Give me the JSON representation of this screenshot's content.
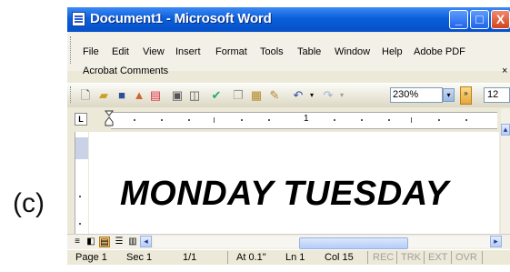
{
  "caption": "(c)",
  "window": {
    "title": "Document1 - Microsoft Word",
    "controls": {
      "minimize": "_",
      "maximize": "□",
      "close": "X"
    }
  },
  "menu": {
    "row1": [
      "File",
      "Edit",
      "View",
      "Insert",
      "Format",
      "Tools",
      "Table",
      "Window",
      "Help",
      "Adobe PDF"
    ],
    "row2": [
      "Acrobat Comments"
    ],
    "overflow": "×"
  },
  "toolbar": {
    "icons": [
      "new-icon",
      "open-icon",
      "save-icon",
      "permission-icon",
      "print-icon",
      "print-preview-icon",
      "spelling-icon",
      "copy-icon",
      "paste-icon",
      "format-painter-icon",
      "undo-icon",
      "redo-icon"
    ],
    "zoom": "230%",
    "font_size": "12"
  },
  "ruler": {
    "marker": "1"
  },
  "document": {
    "text": "MONDAY TUESDAY"
  },
  "status": {
    "page": "Page 1",
    "sec": "Sec 1",
    "pages": "1/1",
    "at": "At 0.1\"",
    "ln": "Ln 1",
    "col": "Col 15",
    "rec": "REC",
    "trk": "TRK",
    "ext": "EXT",
    "ovr": "OVR"
  },
  "colors": {
    "titlebar": "#0a5fd9",
    "chrome": "#ece9d8",
    "active_view": "#f5c87a"
  }
}
